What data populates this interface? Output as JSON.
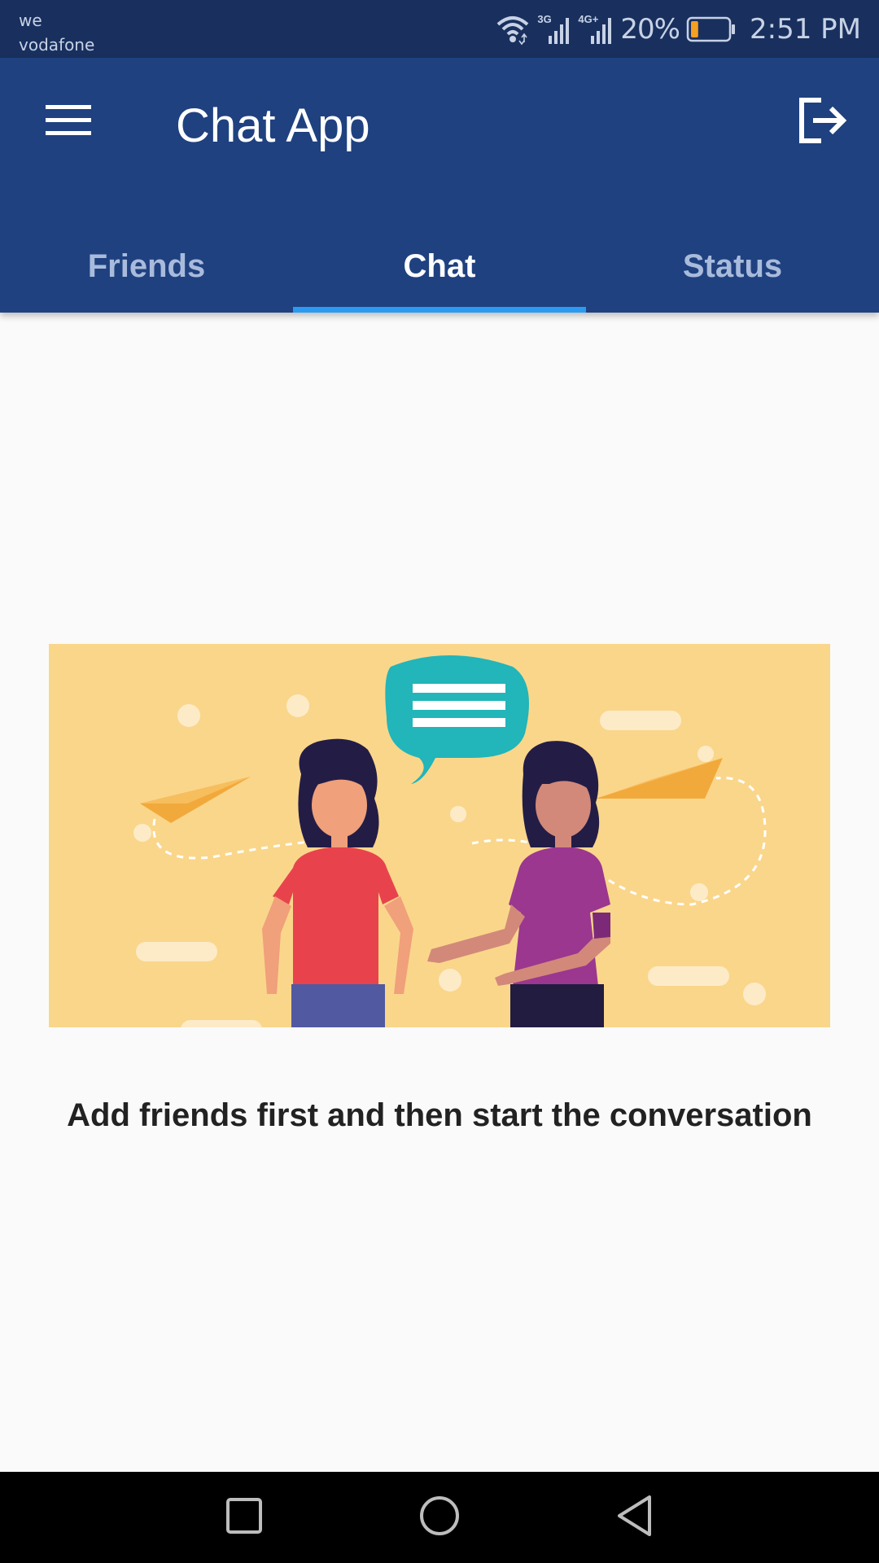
{
  "status_bar": {
    "carrier_line1": "we",
    "carrier_line2": "vodafone",
    "network_3g": "3G",
    "network_4g": "4G+",
    "battery_percent": "20%",
    "time": "2:51 PM",
    "battery_level": 0.2,
    "battery_color": "#f4a022"
  },
  "app_bar": {
    "title": "Chat App",
    "menu_icon": "hamburger-menu-icon",
    "logout_icon": "logout-icon",
    "color": "#1f4180"
  },
  "tabs": [
    {
      "label": "Friends",
      "active": false
    },
    {
      "label": "Chat",
      "active": true
    },
    {
      "label": "Status",
      "active": false
    }
  ],
  "tab_indicator_color": "#2c9af0",
  "empty_state": {
    "message": "Add friends first and then start the conversation",
    "illustration": "two-women-chatting-illustration"
  },
  "nav_bar": {
    "recent_icon": "square-recent-apps-icon",
    "home_icon": "circle-home-icon",
    "back_icon": "triangle-back-icon"
  }
}
